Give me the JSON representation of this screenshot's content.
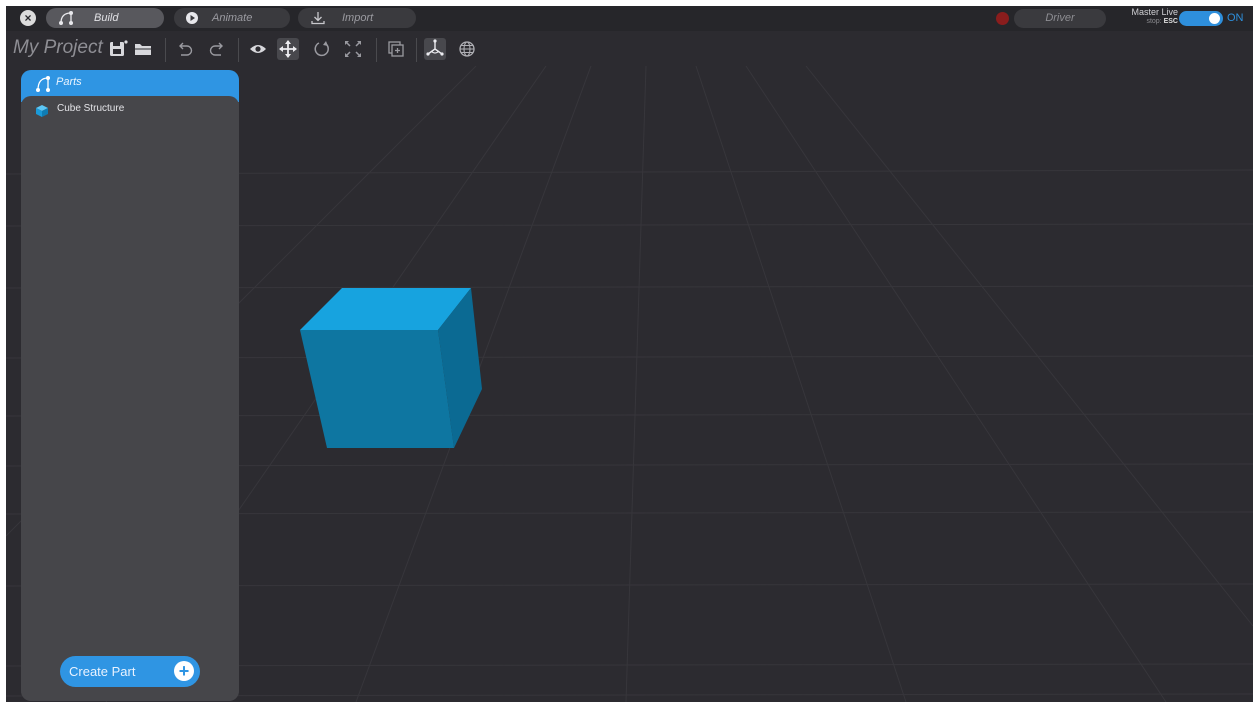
{
  "topbar": {
    "close_glyph": "×",
    "modes": [
      {
        "label": "Build",
        "icon": "parts-branch-icon",
        "active": true
      },
      {
        "label": "Animate",
        "icon": "play-icon",
        "active": false
      },
      {
        "label": "Import",
        "icon": "import-icon",
        "active": false
      }
    ],
    "driver_label": "Driver",
    "master_live_label": "Master Live",
    "stop_hint_prefix": "stop:",
    "stop_hint_key": "ESC",
    "toggle_state_label": "ON",
    "toggle_on": true
  },
  "toolbar": {
    "project_title": "My Project",
    "tools": [
      "save-icon",
      "open-folder-icon",
      "undo-icon",
      "redo-icon",
      "visibility-eye-icon",
      "move-arrows-icon",
      "rotate-icon",
      "scale-icon",
      "add-frame-icon",
      "local-axes-icon",
      "global-world-icon"
    ],
    "active_tools": [
      "move-arrows-icon",
      "local-axes-icon"
    ]
  },
  "parts_panel": {
    "title": "Parts",
    "items": [
      {
        "label": "Cube Structure",
        "icon": "cube-icon"
      }
    ],
    "create_button_label": "Create Part"
  },
  "colors": {
    "accent": "#2f95e3",
    "background": "#2c2b30",
    "panel": "#46464a",
    "cube_top": "#17a3df",
    "cube_front": "#0e76a1",
    "cube_side": "#0b6a93"
  }
}
